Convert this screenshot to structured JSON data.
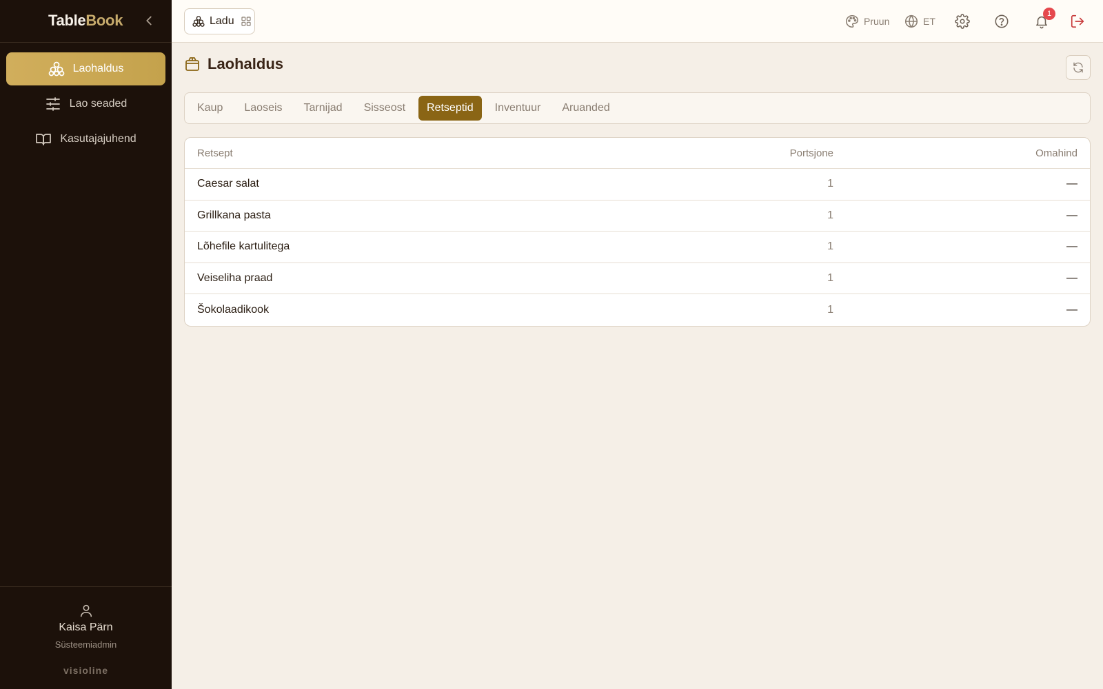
{
  "brand": {
    "part1": "Table",
    "part2": "Book"
  },
  "sidebar": {
    "items": [
      {
        "label": "Laohaldus",
        "icon": "boxes-icon",
        "active": true
      },
      {
        "label": "Lao seaded",
        "icon": "sliders-icon",
        "active": false
      },
      {
        "label": "Kasutajajuhend",
        "icon": "book-icon",
        "active": false
      }
    ],
    "user": {
      "name": "Kaisa Pärn",
      "role": "Süsteemiadmin"
    },
    "footer_brand": "visioline"
  },
  "topbar": {
    "store_label": "Ladu",
    "theme_label": "Pruun",
    "language_label": "ET",
    "notification_count": "1"
  },
  "main": {
    "title": "Laohaldus",
    "tabs": [
      {
        "label": "Kaup",
        "active": false
      },
      {
        "label": "Laoseis",
        "active": false
      },
      {
        "label": "Tarnijad",
        "active": false
      },
      {
        "label": "Sisseost",
        "active": false
      },
      {
        "label": "Retseptid",
        "active": true
      },
      {
        "label": "Inventuur",
        "active": false
      },
      {
        "label": "Aruanded",
        "active": false
      }
    ],
    "table": {
      "headers": [
        "Retsept",
        "Portsjone",
        "Omahind"
      ],
      "rows": [
        [
          "Caesar salat",
          "1",
          "—"
        ],
        [
          "Grillkana pasta",
          "1",
          "—"
        ],
        [
          "Lõhefile kartulitega",
          "1",
          "—"
        ],
        [
          "Veiseliha praad",
          "1",
          "—"
        ],
        [
          "Šokolaadikook",
          "1",
          "—"
        ]
      ]
    }
  },
  "colors": {
    "accent": "#8a6515",
    "sidebar_bg": "#1c110a",
    "active_nav": "#c9a656",
    "badge": "#e5484d",
    "logout": "#c83a3a"
  }
}
